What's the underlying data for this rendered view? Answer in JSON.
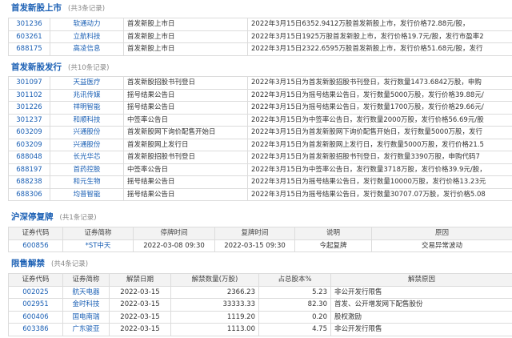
{
  "sections": {
    "ipo_listing": {
      "title": "首发新股上市",
      "count": "(共3条记录)",
      "rows": [
        {
          "code": "301236",
          "name": "软通动力",
          "event": "首发新股上市日",
          "desc": "2022年3月15日6352.9412万股首发新股上市，发行价格72.88元/股，"
        },
        {
          "code": "603261",
          "name": "立航科技",
          "event": "首发新股上市日",
          "desc": "2022年3月15日1925万股首发新股上市，发行价格19.7元/股，发行市盈率2"
        },
        {
          "code": "688175",
          "name": "高凌信息",
          "event": "首发新股上市日",
          "desc": "2022年3月15日2322.6595万股首发新股上市，发行价格51.68元/股，发行"
        }
      ]
    },
    "ipo_issue": {
      "title": "首发新股发行",
      "count": "(共10条记录)",
      "rows": [
        {
          "code": "301097",
          "name": "天益医疗",
          "event": "首发新股招股书刊登日",
          "desc": "2022年3月15日为首发新股招股书刊登日，发行数量1473.6842万股，申购"
        },
        {
          "code": "301102",
          "name": "兆讯传媒",
          "event": "摇号结果公告日",
          "desc": "2022年3月15日为摇号结果公告日，发行数量5000万股，发行价格39.88元/"
        },
        {
          "code": "301226",
          "name": "祥明智能",
          "event": "摇号结果公告日",
          "desc": "2022年3月15日为摇号结果公告日，发行数量1700万股，发行价格29.66元/"
        },
        {
          "code": "301237",
          "name": "和顺科技",
          "event": "中签率公告日",
          "desc": "2022年3月15日为中签率公告日，发行数量2000万股，发行价格56.69元/股"
        },
        {
          "code": "603209",
          "name": "兴通股份",
          "event": "首发新股网下询价配售开始日",
          "desc": "2022年3月15日为首发新股网下询价配售开始日，发行数量5000万股，发行"
        },
        {
          "code": "603209",
          "name": "兴通股份",
          "event": "首发新股网上发行日",
          "desc": "2022年3月15日为首发新股网上发行日，发行数量5000万股，发行价格21.5"
        },
        {
          "code": "688048",
          "name": "长光华芯",
          "event": "首发新股招股书刊登日",
          "desc": "2022年3月15日为首发新股招股书刊登日，发行数量3390万股，申购代码7"
        },
        {
          "code": "688197",
          "name": "首药控股",
          "event": "中签率公告日",
          "desc": "2022年3月15日为中签率公告日，发行数量3718万股，发行价格39.9元/股，"
        },
        {
          "code": "688238",
          "name": "和元生物",
          "event": "摇号结果公告日",
          "desc": "2022年3月15日为摇号结果公告日，发行数量10000万股，发行价格13.23元"
        },
        {
          "code": "688306",
          "name": "均普智能",
          "event": "摇号结果公告日",
          "desc": "2022年3月15日为摇号结果公告日，发行数量30707.07万股，发行价格5.08"
        }
      ]
    },
    "suspension": {
      "title": "沪深停复牌",
      "count": "(共1条记录)",
      "headers": [
        "证券代码",
        "证券简称",
        "停牌时间",
        "复牌时间",
        "说明",
        "原因"
      ],
      "rows": [
        {
          "code": "600856",
          "name": "*ST中天",
          "suspend": "2022-03-08 09:30",
          "resume": "2022-03-15 09:30",
          "note": "今起复牌",
          "reason": "交易异常波动"
        }
      ]
    },
    "unlock": {
      "title": "限售解禁",
      "count": "(共4条记录)",
      "headers": [
        "证券代码",
        "证券简称",
        "解禁日期",
        "解禁数量(万股)",
        "占总股本%",
        "解禁原因"
      ],
      "rows": [
        {
          "code": "002025",
          "name": "航天电器",
          "date": "2022-03-15",
          "qty": "2366.23",
          "pct": "5.23",
          "reason": "非公开发行限售"
        },
        {
          "code": "002951",
          "name": "金时科技",
          "date": "2022-03-15",
          "qty": "33333.33",
          "pct": "82.30",
          "reason": "首发、公开增发网下配售股份"
        },
        {
          "code": "600406",
          "name": "国电南瑞",
          "date": "2022-03-15",
          "qty": "1119.20",
          "pct": "0.20",
          "reason": "股权激励"
        },
        {
          "code": "603386",
          "name": "广东骏亚",
          "date": "2022-03-15",
          "qty": "1113.00",
          "pct": "4.75",
          "reason": "非公开发行限售"
        }
      ]
    }
  }
}
